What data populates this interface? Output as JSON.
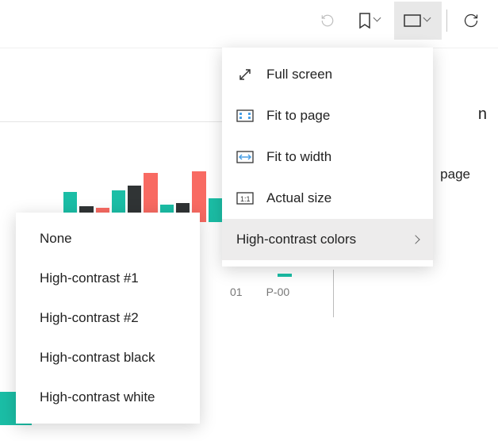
{
  "toolbar": {
    "reset_icon": "reset",
    "bookmark_icon": "bookmark",
    "view_icon": "view-rectangle",
    "refresh_icon": "refresh"
  },
  "view_menu": {
    "items": [
      {
        "icon": "fullscreen",
        "label": "Full screen"
      },
      {
        "icon": "fit-page",
        "label": "Fit to page"
      },
      {
        "icon": "fit-width",
        "label": "Fit to width"
      },
      {
        "icon": "actual-size",
        "label": "Actual size"
      }
    ],
    "submenu_label": "High-contrast colors"
  },
  "contrast_menu": {
    "items": [
      "None",
      "High-contrast #1",
      "High-contrast #2",
      "High-contrast black",
      "High-contrast white"
    ]
  },
  "chart_data": {
    "type": "bar",
    "colors": {
      "series1": "#1bbea6",
      "series2": "#303435",
      "series3": "#f86a62"
    },
    "bars": [
      {
        "color": "teal",
        "h": 38
      },
      {
        "color": "dark",
        "h": 20
      },
      {
        "color": "red",
        "h": 18
      },
      {
        "color": "teal",
        "h": 40
      },
      {
        "color": "dark",
        "h": 46
      },
      {
        "color": "red",
        "h": 62
      },
      {
        "color": "teal",
        "h": 22
      },
      {
        "color": "dark",
        "h": 24
      },
      {
        "color": "red",
        "h": 64
      },
      {
        "color": "teal",
        "h": 30
      }
    ],
    "ticks": [
      "01",
      "P-00"
    ]
  },
  "page_hint_right": "page",
  "frag_p": "p",
  "frag_n": "n"
}
